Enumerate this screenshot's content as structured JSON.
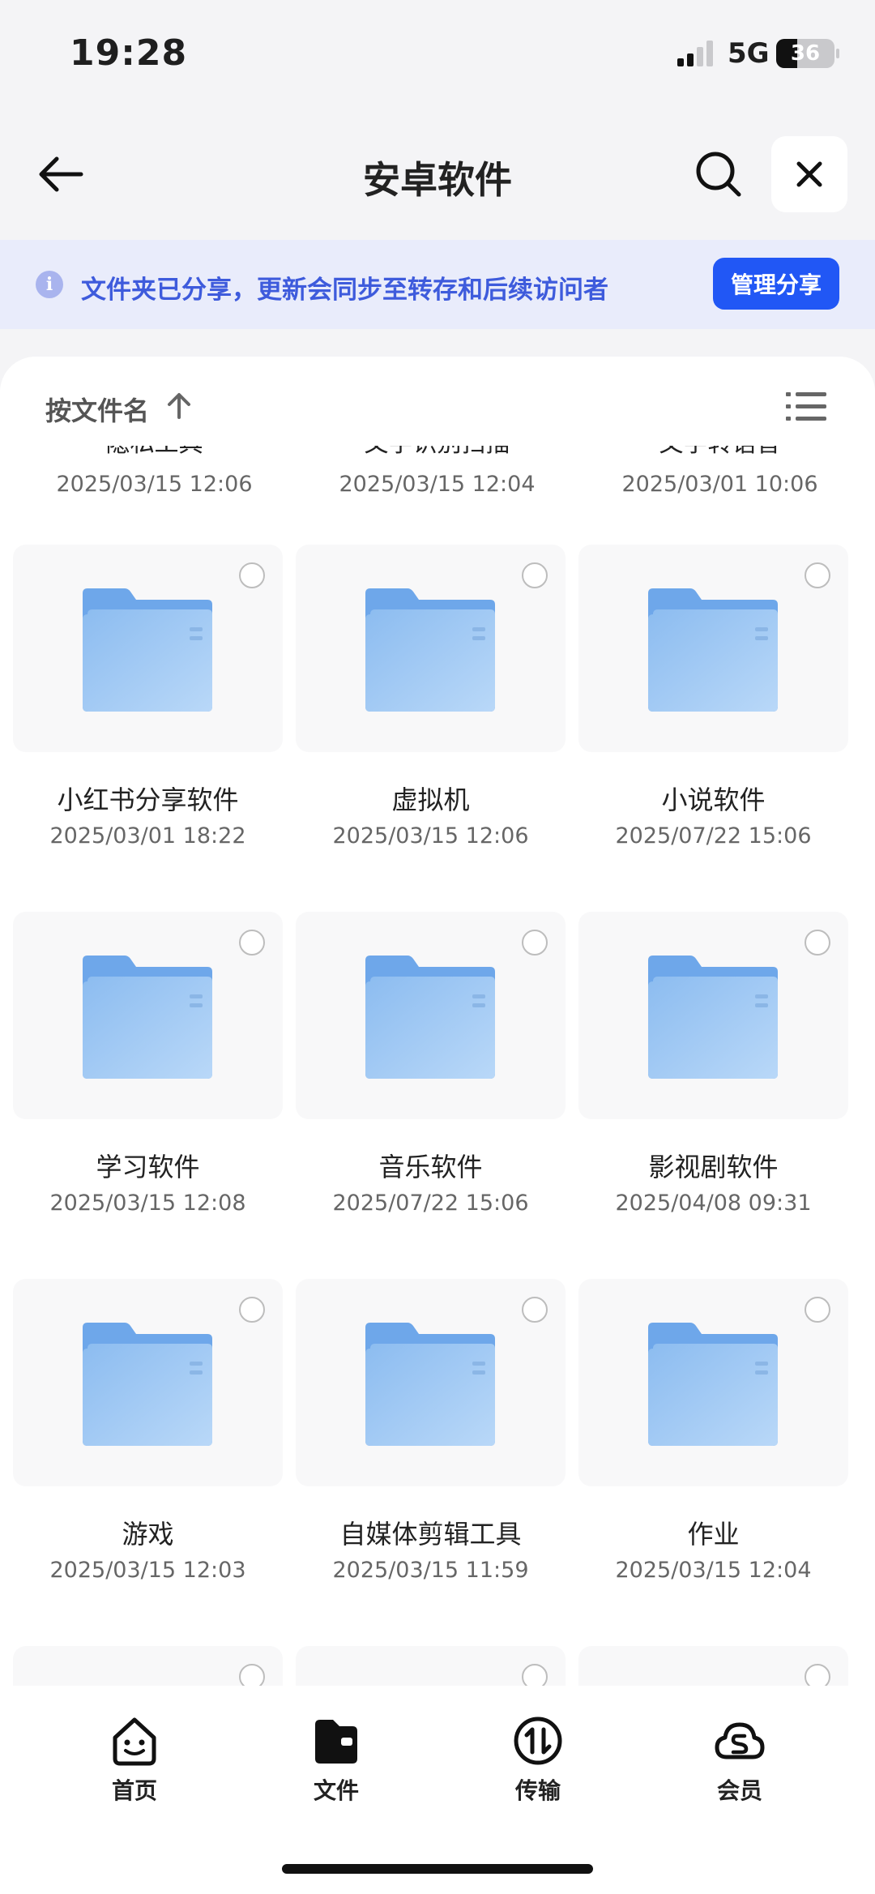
{
  "status_bar": {
    "time": "19:28",
    "network": "5G",
    "battery": "36",
    "battery_level": 0.36
  },
  "header": {
    "title": "安卓软件"
  },
  "banner": {
    "text": "文件夹已分享，更新会同步至转存和后续访问者",
    "action": "管理分享",
    "info_glyph": "i"
  },
  "sort": {
    "label": "按文件名"
  },
  "partial_row": [
    {
      "name": "隐私工具",
      "date": "2025/03/15 12:06"
    },
    {
      "name": "文字识别扫描",
      "date": "2025/03/15 12:04"
    },
    {
      "name": "文字转语音",
      "date": "2025/03/01 10:06"
    }
  ],
  "folders": [
    {
      "name": "小红书分享软件",
      "date": "2025/03/01 18:22"
    },
    {
      "name": "虚拟机",
      "date": "2025/03/15 12:06"
    },
    {
      "name": "小说软件",
      "date": "2025/07/22 15:06"
    },
    {
      "name": "学习软件",
      "date": "2025/03/15 12:08"
    },
    {
      "name": "音乐软件",
      "date": "2025/07/22 15:06"
    },
    {
      "name": "影视剧软件",
      "date": "2025/04/08 09:31"
    },
    {
      "name": "游戏",
      "date": "2025/03/15 12:03"
    },
    {
      "name": "自媒体剪辑工具",
      "date": "2025/03/15 11:59"
    },
    {
      "name": "作业",
      "date": "2025/03/15 12:04"
    }
  ],
  "nav": [
    {
      "label": "首页",
      "icon": "home-face-icon"
    },
    {
      "label": "文件",
      "icon": "folder-wallet-icon"
    },
    {
      "label": "传输",
      "icon": "transfer-icon"
    },
    {
      "label": "会员",
      "icon": "membership-cloud-icon"
    }
  ],
  "colors": {
    "accent": "#2157f5",
    "banner_bg": "#e9ecfb",
    "banner_text": "#3e5bdc",
    "folder": "#8fc0f2"
  }
}
